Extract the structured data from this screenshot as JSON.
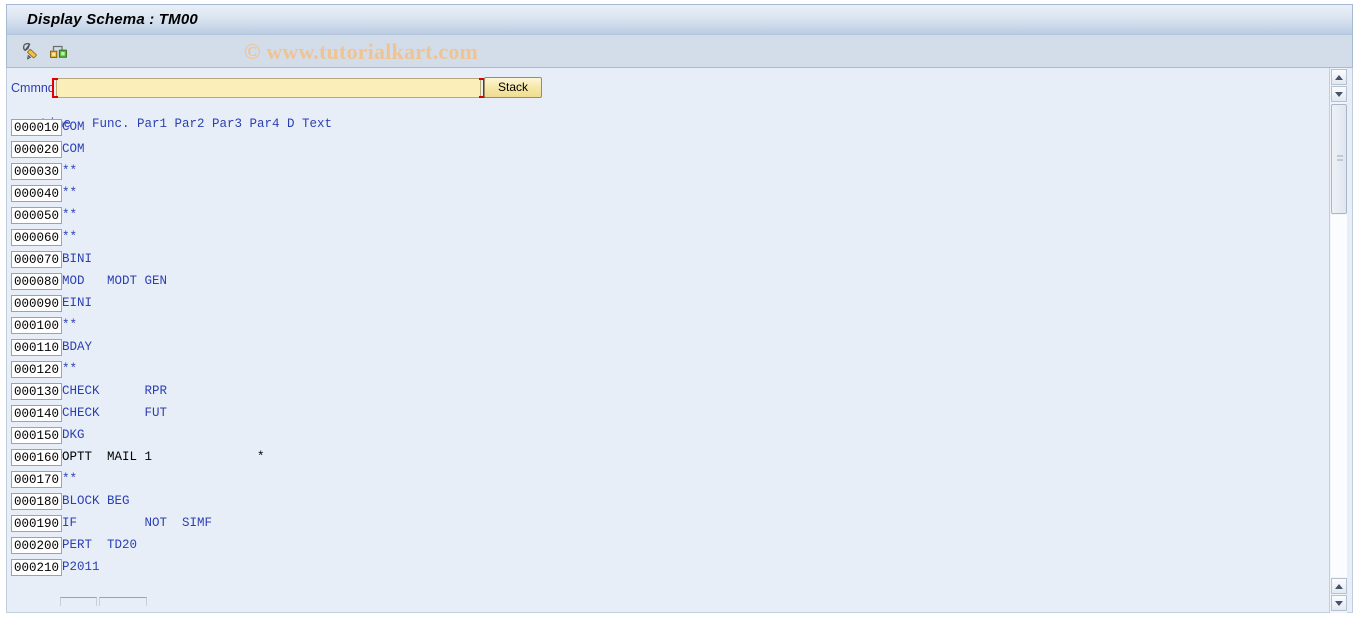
{
  "window": {
    "title": "Display Schema : TM00"
  },
  "toolbar": {
    "icons": [
      {
        "name": "pencil-edit-icon",
        "label": "Display/Change"
      },
      {
        "name": "hierarchy-structure-icon",
        "label": "Structure"
      }
    ]
  },
  "watermark": {
    "text": "© www.tutorialkart.com",
    "color": "#f0c391"
  },
  "command": {
    "label": "Cmmnd",
    "value": "",
    "placeholder": "",
    "required": true,
    "stack_button": "Stack"
  },
  "grid": {
    "columns": [
      "Line",
      "Func.",
      "Par1",
      "Par2",
      "Par3",
      "Par4",
      "D",
      "Text"
    ],
    "header_text": "Func. Par1 Par2 Par3 Par4 D Text",
    "rows": [
      {
        "line": "000010",
        "text": "COM",
        "color": "blue"
      },
      {
        "line": "000020",
        "text": "COM",
        "color": "blue"
      },
      {
        "line": "000030",
        "text": "**",
        "color": "blue"
      },
      {
        "line": "000040",
        "text": "**",
        "color": "blue"
      },
      {
        "line": "000050",
        "text": "**",
        "color": "blue"
      },
      {
        "line": "000060",
        "text": "**",
        "color": "blue"
      },
      {
        "line": "000070",
        "text": "BINI",
        "color": "blue"
      },
      {
        "line": "000080",
        "text": "MOD   MODT GEN",
        "color": "blue"
      },
      {
        "line": "000090",
        "text": "EINI",
        "color": "blue"
      },
      {
        "line": "000100",
        "text": "**",
        "color": "blue"
      },
      {
        "line": "000110",
        "text": "BDAY",
        "color": "blue"
      },
      {
        "line": "000120",
        "text": "**",
        "color": "blue"
      },
      {
        "line": "000130",
        "text": "CHECK      RPR",
        "color": "blue"
      },
      {
        "line": "000140",
        "text": "CHECK      FUT",
        "color": "blue"
      },
      {
        "line": "000150",
        "text": "DKG",
        "color": "blue"
      },
      {
        "line": "000160",
        "text": "OPTT  MAIL 1              *",
        "color": "black"
      },
      {
        "line": "000170",
        "text": "**",
        "color": "blue"
      },
      {
        "line": "000180",
        "text": "BLOCK BEG",
        "color": "blue"
      },
      {
        "line": "000190",
        "text": "IF         NOT  SIMF",
        "color": "blue"
      },
      {
        "line": "000200",
        "text": "PERT  TD20",
        "color": "blue"
      },
      {
        "line": "000210",
        "text": "P2011",
        "color": "blue"
      }
    ]
  },
  "scrollbar": {
    "up_label": "scroll up",
    "down_label": "scroll down"
  },
  "colors": {
    "title_bar": "#bccde3",
    "toolbar": "#d3dce9",
    "content_bg": "#e8eef7",
    "text_blue": "#2b3fb5",
    "command_field": "#fbeeb8",
    "required_marker": "#e00000"
  }
}
